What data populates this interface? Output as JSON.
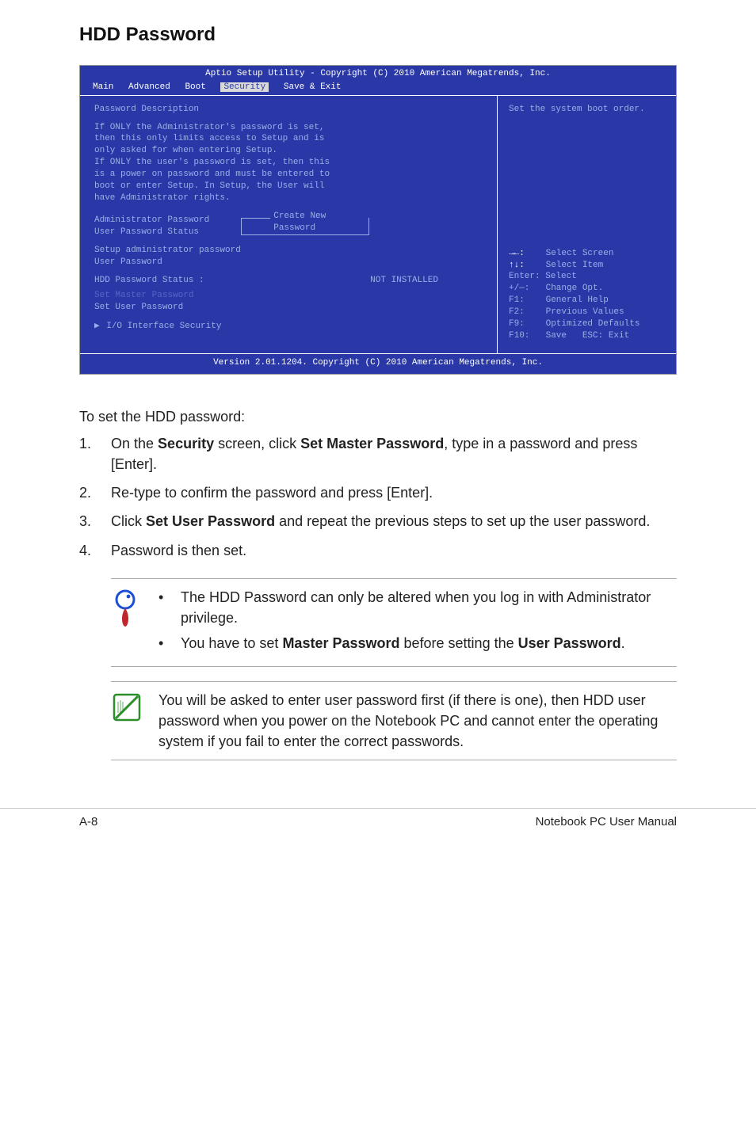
{
  "title": "HDD Password",
  "bios": {
    "topline": "Aptio Setup Utility - Copyright (C) 2010 American Megatrends, Inc.",
    "menu": {
      "main": "Main",
      "advanced": "Advanced",
      "boot": "Boot",
      "security": "Security",
      "saveexit": "Save & Exit"
    },
    "left": {
      "pwdesc_title": "Password Description",
      "pwdesc1": "If ONLY the Administrator's password is set,",
      "pwdesc2": "then this only limits access to Setup and is",
      "pwdesc3": "only asked for when entering Setup.",
      "pwdesc4": "If ONLY the user's password is set, then this",
      "pwdesc5": "is a power on password and must be entered to",
      "pwdesc6": "boot or enter Setup. In Setup, the User will",
      "pwdesc7": "have Administrator rights.",
      "admin_pw": "Administrator Password",
      "user_pw_status": "User Password Status",
      "create_new_pw": "Create New Password",
      "setup_admin_pw": "Setup administrator password",
      "user_pw": "User Password",
      "hdd_pw_status": "HDD Password Status :",
      "hdd_pw_val": "NOT INSTALLED",
      "set_master": "Set Master Password",
      "set_user": "Set User Password",
      "io_iface": "I/O Interface Security"
    },
    "right": {
      "hint": "Set the system boot order.",
      "k_arrows": "→←:",
      "select_screen": "Select Screen",
      "k_updown": "↑↓:",
      "select_item": "Select Item",
      "k_enter": "Enter: Select",
      "k_pm": "+/—:",
      "change_opt": "Change Opt.",
      "k_f1": "F1:",
      "general_help": "General Help",
      "k_f2": "F2:",
      "prev_vals": "Previous Values",
      "k_f9": "F9:",
      "opt_def": "Optimized Defaults",
      "k_f10": "F10:",
      "save": "Save",
      "esc": "ESC: Exit"
    },
    "version": "Version 2.01.1204. Copyright (C) 2010 American Megatrends, Inc."
  },
  "body": {
    "intro": "To set the HDD password:",
    "steps": [
      {
        "num": "1.",
        "pre": "On the ",
        "b1": "Security",
        "mid": " screen, click ",
        "b2": "Set Master Password",
        "post": ", type in a password and press [Enter]."
      },
      {
        "num": "2.",
        "text": "Re-type to confirm the password and press [Enter]."
      },
      {
        "num": "3.",
        "pre": "Click ",
        "b1": "Set User Password",
        "post": " and repeat the previous steps to set up the user password."
      },
      {
        "num": "4.",
        "text": "Password is then set."
      }
    ]
  },
  "callout1": {
    "b1_text": "The HDD Password can only be altered when you log in with Administrator privilege.",
    "b2_pre": "You have to set ",
    "b2_b1": "Master Password",
    "b2_mid": " before setting the ",
    "b2_b2": "User Password",
    "b2_post": "."
  },
  "callout2": {
    "text": "You will be asked to enter user password first (if there is one), then HDD user password when you power on the Notebook PC and cannot enter the operating system if you fail to enter the correct passwords."
  },
  "footer": {
    "left": "A-8",
    "right": "Notebook PC User Manual"
  }
}
